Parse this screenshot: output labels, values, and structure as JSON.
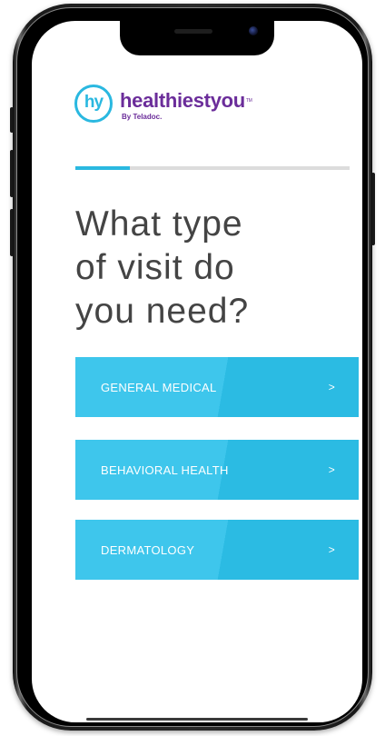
{
  "brand": {
    "logo_mark": "hy",
    "wordmark": "healthiestyou",
    "trademark": "TM",
    "byline": "By Teladoc."
  },
  "progress": {
    "fraction": 0.2
  },
  "heading": {
    "line1": "What type",
    "line2": "of visit do",
    "line3": "you need?"
  },
  "options": [
    {
      "label": "GENERAL MEDICAL",
      "chevron": ">"
    },
    {
      "label": "BEHAVIORAL HEALTH",
      "chevron": ">"
    },
    {
      "label": "DERMATOLOGY",
      "chevron": ">"
    }
  ],
  "colors": {
    "accent": "#2ab8e0",
    "brand_purple": "#6b2d9a",
    "button": "#3ec6ec",
    "heading_text": "#444444"
  }
}
